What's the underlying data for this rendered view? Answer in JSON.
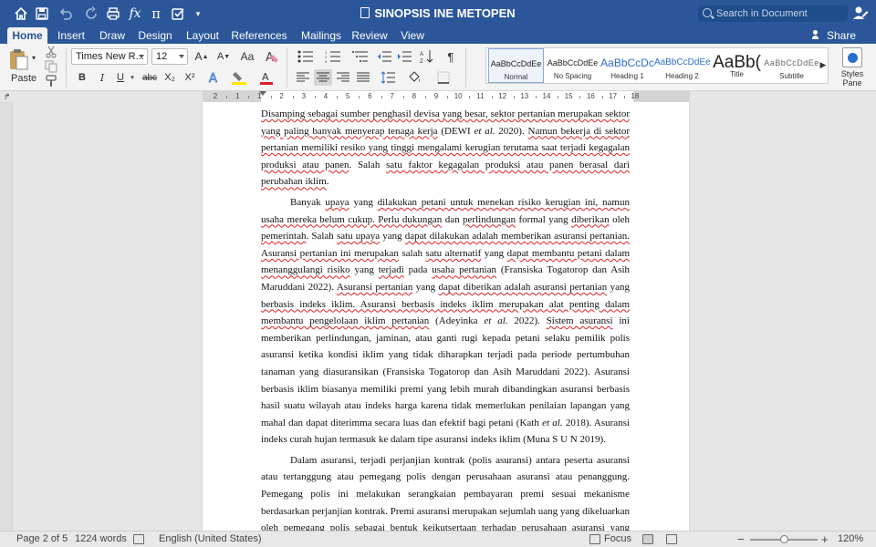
{
  "window": {
    "title": "SINOPSIS INE METOPEN",
    "search_placeholder": "Search in Document",
    "toolbar_icons": [
      "home-icon",
      "save-icon",
      "undo-icon",
      "redo-icon",
      "print-icon",
      "function-icon",
      "pi-icon",
      "checkbox-icon",
      "customize-icon"
    ]
  },
  "tabs": [
    "Home",
    "Insert",
    "Draw",
    "Design",
    "Layout",
    "References",
    "Mailings",
    "Review",
    "View"
  ],
  "active_tab": "Home",
  "share_label": "Share",
  "ribbon": {
    "paste_label": "Paste",
    "font_name": "Times New R...",
    "font_size": "12",
    "bold": "B",
    "italic": "I",
    "underline": "U",
    "strikethrough": "abc",
    "subscript": "X₂",
    "superscript": "X²",
    "styles": [
      {
        "sample": "AaBbCcDdEe",
        "name": "Normal",
        "selected": true
      },
      {
        "sample": "AaBbCcDdEe",
        "name": "No Spacing",
        "selected": false
      },
      {
        "sample": "AaBbCcDc",
        "name": "Heading 1",
        "selected": false
      },
      {
        "sample": "AaBbCcDdEe",
        "name": "Heading 2",
        "selected": false
      },
      {
        "sample": "AaBb(",
        "name": "Title",
        "selected": false
      },
      {
        "sample": "AaBbCcDdEe",
        "name": "Subtitle",
        "selected": false
      }
    ],
    "styles_pane_label": "Styles Pane"
  },
  "ruler": {
    "numbers": [
      "2",
      "1",
      "1",
      "2",
      "3",
      "4",
      "5",
      "6",
      "7",
      "8",
      "9",
      "10",
      "11",
      "12",
      "13",
      "14",
      "15",
      "16",
      "17",
      "18"
    ]
  },
  "document": {
    "paragraphs": [
      {
        "indent": false,
        "runs": [
          {
            "t": "Disamping sebagai sumber penghasil devisa yang besar, sektor pertanian merupakan sektor yang paling banyak menyerap tenaga kerja",
            "sq": true
          },
          {
            "t": " (DEWI ",
            "sq": false
          },
          {
            "t": "et al.",
            "sq": false,
            "i": true
          },
          {
            "t": " 2020). ",
            "sq": false
          },
          {
            "t": "Namun bekerja di sektor pertanian memiliki resiko yang tinggi mengalami kerugian terutama saat terjadi kegagalan produksi atau panen",
            "sq": true
          },
          {
            "t": ". Salah ",
            "sq": false
          },
          {
            "t": "satu faktor kegagalan produksi atau panen berasal dari perubahan iklim",
            "sq": true
          },
          {
            "t": ".",
            "sq": false
          }
        ]
      },
      {
        "indent": true,
        "runs": [
          {
            "t": "Banyak ",
            "sq": false
          },
          {
            "t": "upaya",
            "sq": true
          },
          {
            "t": " yang ",
            "sq": false
          },
          {
            "t": "dilakukan petani untuk menekan risiko kerugian ini, namun usaha mereka belum cukup. Perlu dukungan",
            "sq": true
          },
          {
            "t": " dan ",
            "sq": false
          },
          {
            "t": "perlindungan",
            "sq": true
          },
          {
            "t": " formal yang ",
            "sq": false
          },
          {
            "t": "diberikan",
            "sq": true
          },
          {
            "t": " oleh ",
            "sq": false
          },
          {
            "t": "pemerintah",
            "sq": true
          },
          {
            "t": ". Salah ",
            "sq": false
          },
          {
            "t": "satu upaya",
            "sq": true
          },
          {
            "t": " yang ",
            "sq": false
          },
          {
            "t": "dapat dilakukan adalah memberikan asuransi pertanian. Asuransi pertanian ini merupakan",
            "sq": true
          },
          {
            "t": " salah ",
            "sq": false
          },
          {
            "t": "satu alternatif",
            "sq": true
          },
          {
            "t": " yang ",
            "sq": false
          },
          {
            "t": "dapat membantu petani dalam menanggulangi risiko",
            "sq": true
          },
          {
            "t": " yang ",
            "sq": false
          },
          {
            "t": "terjadi",
            "sq": true
          },
          {
            "t": " pada ",
            "sq": false
          },
          {
            "t": "usaha pertanian",
            "sq": true
          },
          {
            "t": " (Fransiska Togatorop dan Asih Maruddani 2022). ",
            "sq": false
          },
          {
            "t": "Asuransi pertanian",
            "sq": true
          },
          {
            "t": " yang ",
            "sq": false
          },
          {
            "t": "dapat diberikan adalah asuransi pertanian",
            "sq": true
          },
          {
            "t": " yang ",
            "sq": false
          },
          {
            "t": "berbasis indeks iklim. Asuransi berbasis indeks iklim merupakan alat penting dalam membantu pengelolaan iklim pertanian",
            "sq": true
          },
          {
            "t": " (Adeyinka ",
            "sq": false
          },
          {
            "t": "et al.",
            "sq": false,
            "i": true
          },
          {
            "t": " 2022). ",
            "sq": false
          },
          {
            "t": "Sistem asuransi",
            "sq": true
          },
          {
            "t": " ini memberikan perlindungan, jaminan, atau ganti rugi kepada petani selaku pemilik polis asuransi ketika kondisi iklim yang tidak diharapkan terjadi pada periode pertumbuhan tanaman yang diasuransikan (Fransiska Togatorop dan Asih Maruddani 2022). Asuransi berbasis iklim biasanya memiliki premi yang lebih murah dibandingkan asuransi berbasis hasil suatu wilayah atau indeks harga karena tidak memerlukan penilaian lapangan yang mahal dan dapat diterimma secara luas dan efektif bagi petani (Kath ",
            "sq": false
          },
          {
            "t": "et al.",
            "sq": false,
            "i": true
          },
          {
            "t": " 2018). Asuransi indeks curah hujan termasuk ke dalam tipe asuransi indeks iklim (Muna S U N 2019).",
            "sq": false
          }
        ]
      },
      {
        "indent": true,
        "runs": [
          {
            "t": "Dalam asuransi, terjadi perjanjian kontrak (polis asuransi) antara peserta asuransi atau tertanggung atau pemegang polis dengan perusahaan asuransi atau penanggung. Pemegang polis ini melakukan serangkaian pembayaran premi sesuai mekanisme berdasarkan perjanjian kontrak. Premi asuransi merupakan sejumlah uang yang dikeluarkan oleh pemegang polis sebagai bentuk keikutsertaan terhadap perusahaan asuransi yang dibayarkan selama periode",
            "sq": false
          }
        ]
      }
    ]
  },
  "status": {
    "page": "Page 2 of 5",
    "words": "1224 words",
    "language": "English (United States)",
    "focus": "Focus",
    "zoom": "120%",
    "zoom_minus": "−",
    "zoom_plus": "+",
    "zoom_level_fraction": 0.5
  }
}
